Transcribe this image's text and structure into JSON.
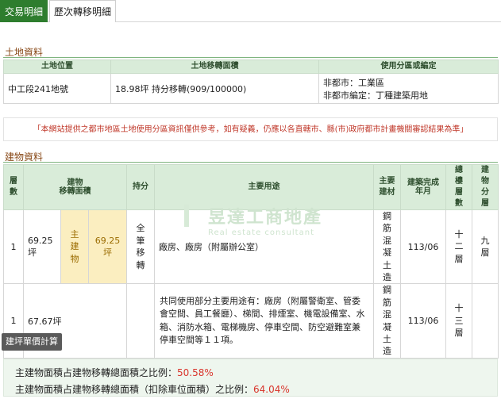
{
  "tabs": [
    {
      "label": "交易明細",
      "active": true
    },
    {
      "label": "歷次轉移明細",
      "active": false
    }
  ],
  "land": {
    "title": "土地資料",
    "headers": [
      "土地位置",
      "土地移轉面積",
      "使用分區或編定"
    ],
    "row": {
      "location": "中工段241地號",
      "area": "18.98坪 持分移轉(909/100000)",
      "zoning_line1": "非都市：工業區",
      "zoning_line2": "非都市編定：丁種建築用地"
    }
  },
  "notice": "「本網站提供之都市地區土地使用分區資訊僅供參考，如有疑義，仍應以各直轄市、縣(市)政府都市計畫機關審認結果為準」",
  "building": {
    "title": "建物資料",
    "headers": {
      "floor": "層數",
      "area": "建物\n移轉面積",
      "share": "持分",
      "usage": "主要用途",
      "material": "主要建材",
      "completed": "建築完成年月",
      "total_floors": "總樓層數",
      "zoning": "建物分層"
    },
    "rows": [
      {
        "floor": "1",
        "area": "69.25坪",
        "main_label": "主建物",
        "main_area": "69.25坪",
        "share": "全筆移轉",
        "usage": "廠房、廠房（附屬辦公室）",
        "material": "鋼筋混凝土造",
        "completed": "113/06",
        "total_floors": "十二層",
        "zoning": "九層"
      },
      {
        "floor": "1",
        "area": "67.67坪",
        "usage": "共同使用部分主要用途有：廠房（附屬警衛室、管委會空間、員工餐廳）、梯間、排煙室、機電設備室、水箱、消防水箱、電梯機房、停車空間、防空避難室兼停車空間等１１項。",
        "material": "鋼筋混凝土造",
        "completed": "113/06",
        "total_floors": "十三層"
      }
    ]
  },
  "watermark": {
    "name": "昱達工商地產",
    "sub": "Real estate consultant"
  },
  "calc_button": "建坪單價計算",
  "ratios": {
    "line1_label": "主建物面積占建物移轉總面積之比例：",
    "line1_value": "50.58%",
    "line2_label": "主建物面積占建物移轉總面積（扣除車位面積）之比例：",
    "line2_value": "64.04%"
  }
}
